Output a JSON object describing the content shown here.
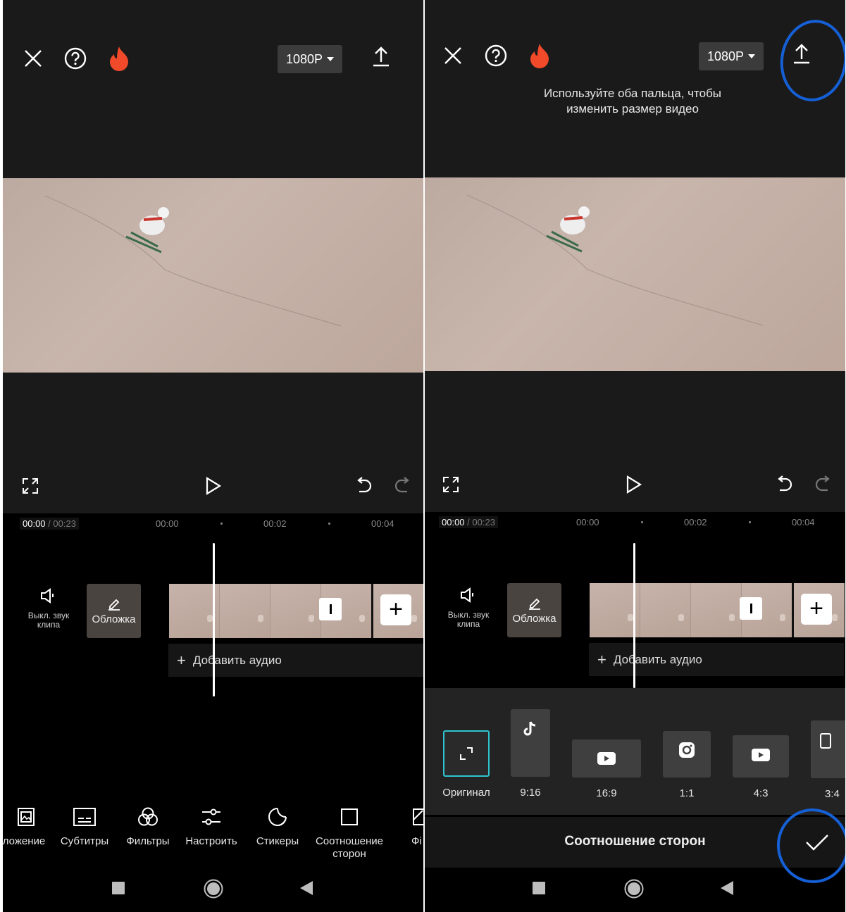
{
  "resolution_label": "1080P",
  "hint_text": "Используйте оба пальца, чтобы изменить размер видео",
  "time": {
    "current": "00:00",
    "total": "/ 00:23",
    "ticks": [
      "00:00",
      "00:02",
      "00:04"
    ]
  },
  "track": {
    "mute_label": "Выкл. звук клипа",
    "cover_label": "Обложка",
    "add_audio_label": "Добавить аудио",
    "add_audio_icon": "+",
    "add_clip_icon": "+"
  },
  "toolbar": {
    "items": [
      {
        "icon": "overlay-icon",
        "label": "ложение"
      },
      {
        "icon": "subtitles-icon",
        "label": "Субтитры"
      },
      {
        "icon": "filters-icon",
        "label": "Фильтры"
      },
      {
        "icon": "adjust-icon",
        "label": "Настроить"
      },
      {
        "icon": "stickers-icon",
        "label": "Стикеры"
      },
      {
        "icon": "aspect-ratio-icon",
        "label": "Соотношение сторон"
      },
      {
        "icon": "effects-icon",
        "label": "Фі"
      }
    ]
  },
  "aspect": {
    "title": "Соотношение сторон",
    "options": [
      {
        "label": "Оригинал",
        "icon": "expand-icon",
        "selected": true
      },
      {
        "label": "9:16",
        "icon": "tiktok-icon"
      },
      {
        "label": "16:9",
        "icon": "youtube-icon"
      },
      {
        "label": "1:1",
        "icon": "instagram-icon"
      },
      {
        "label": "4:3",
        "icon": "youtube-icon"
      },
      {
        "label": "3:4",
        "icon": "phone-portrait-icon"
      }
    ]
  },
  "colors": {
    "accent": "#2ec4cf",
    "annotation": "#1560d6",
    "fire": "#f04a2a"
  }
}
